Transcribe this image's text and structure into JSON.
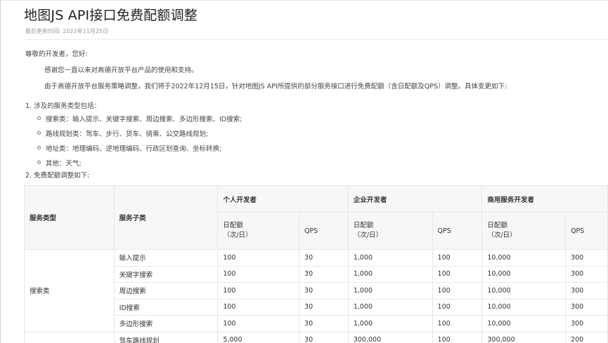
{
  "article": {
    "title": "地图JS API接口免费配额调整",
    "updated": "最后更新时间: 2022年11月25日",
    "greeting": "尊敬的开发者，您好:",
    "thanks": "感谢您一直以来对高德开放平台产品的使用和支持。",
    "intro": "由于高德开放平台服务策略调整，我们将于2022年12月15日，针对地图JS API所提供的部分服务接口进行免费配额（含日配额及QPS）调整。具体变更如下:",
    "section1": "1. 涉及的服务类型包括：",
    "bullets": [
      "搜索类：输入提示、关键字搜索、周边搜索、多边形搜索、ID搜索;",
      "路线规划类：驾车、步行、货车、骑乘、公交路线规划;",
      "地址类：地理编码、逆地理编码、行政区划查询、坐标转换;",
      "其他：天气;"
    ],
    "section2": "2. 免费配额调整如下:"
  },
  "table": {
    "headers": {
      "service_type": "服务类型",
      "service_sub": "服务子类",
      "personal": "个人开发者",
      "enterprise": "企业开发者",
      "commercial": "商用服务开发者",
      "daily_line1": "日配额",
      "daily_line2": "（次/日）",
      "qps": "QPS"
    },
    "groups": [
      {
        "type": "搜索类",
        "rows": [
          {
            "sub": "输入提示",
            "p_daily": "100",
            "p_qps": "30",
            "e_daily": "1,000",
            "e_qps": "100",
            "c_daily": "10,000",
            "c_qps": "300"
          },
          {
            "sub": "关键字搜索",
            "p_daily": "100",
            "p_qps": "30",
            "e_daily": "1,000",
            "e_qps": "100",
            "c_daily": "10,000",
            "c_qps": "300"
          },
          {
            "sub": "周边搜索",
            "p_daily": "100",
            "p_qps": "30",
            "e_daily": "1,000",
            "e_qps": "100",
            "c_daily": "10,000",
            "c_qps": "300"
          },
          {
            "sub": "ID搜索",
            "p_daily": "100",
            "p_qps": "30",
            "e_daily": "1,000",
            "e_qps": "100",
            "c_daily": "10,000",
            "c_qps": "300"
          },
          {
            "sub": "多边形搜索",
            "p_daily": "100",
            "p_qps": "30",
            "e_daily": "1,000",
            "e_qps": "100",
            "c_daily": "10,000",
            "c_qps": "300"
          }
        ]
      },
      {
        "type": "",
        "rows": [
          {
            "sub": "驾车路线规划",
            "p_daily": "5,000",
            "p_qps": "30",
            "e_daily": "300,000",
            "e_qps": "100",
            "c_daily": "300,000",
            "c_qps": "200"
          }
        ]
      }
    ]
  }
}
